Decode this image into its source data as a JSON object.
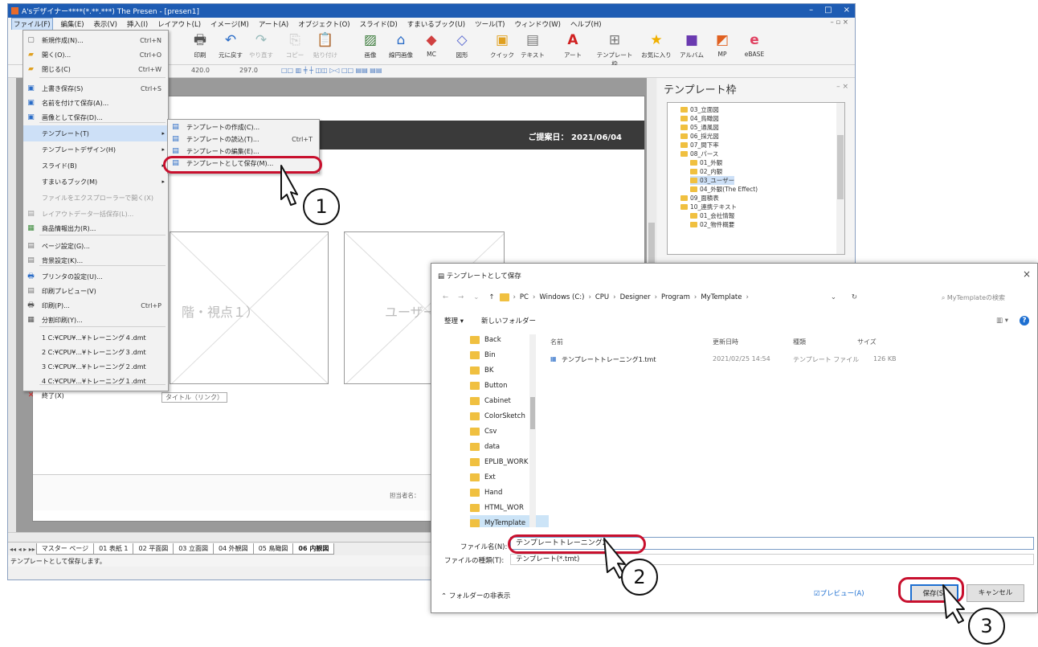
{
  "window": {
    "title": "A'sデザイナー****(*.**.***) The Presen - [presen1]",
    "controls": [
      "–",
      "□",
      "×"
    ]
  },
  "menubar": [
    "ファイル(F)",
    "編集(E)",
    "表示(V)",
    "挿入(I)",
    "レイアウト(L)",
    "イメージ(M)",
    "アート(A)",
    "オブジェクト(O)",
    "スライド(D)",
    "すまいるブック(U)",
    "ツール(T)",
    "ウィンドウ(W)",
    "ヘルプ(H)"
  ],
  "toolbar": [
    "印刷",
    "元に戻す",
    "やり直す",
    "コピー",
    "貼り付け",
    "画像",
    "線円画像",
    "MC",
    "図形",
    "クイック",
    "テキスト",
    "アート",
    "テンプレート枠",
    "お気に入り",
    "アルバム",
    "MP",
    "eBASE"
  ],
  "toolbar2": {
    "w": "420.0",
    "h": "297.0"
  },
  "page": {
    "date_label": "ご提案日： 2021/06/04",
    "frame1_text": "階・視点１）",
    "frame2_text": "ユーザー",
    "caption": "タイトル（リンク）",
    "footer_text": "担当者名："
  },
  "file_menu": [
    {
      "label": "新規作成(N)...",
      "shortcut": "Ctrl+N",
      "icon": "new-doc-icon"
    },
    {
      "label": "開く(O)...",
      "shortcut": "Ctrl+O",
      "icon": "open-folder-icon"
    },
    {
      "label": "閉じる(C)",
      "shortcut": "Ctrl+W",
      "icon": "close-doc-icon"
    },
    {
      "label": "上書き保存(S)",
      "shortcut": "Ctrl+S",
      "icon": "save-icon"
    },
    {
      "label": "名前を付けて保存(A)...",
      "shortcut": "",
      "icon": "save-as-icon"
    },
    {
      "label": "画像として保存(D)...",
      "shortcut": "",
      "icon": "save-image-icon"
    },
    {
      "label": "テンプレート(T)",
      "shortcut": "",
      "icon": ""
    },
    {
      "label": "テンプレートデザイン(H)",
      "shortcut": "",
      "icon": ""
    },
    {
      "label": "スライド(B)",
      "shortcut": "",
      "icon": ""
    },
    {
      "label": "すまいるブック(M)",
      "shortcut": "",
      "icon": ""
    },
    {
      "label": "ファイルをエクスプローラーで開く(X)",
      "shortcut": "",
      "icon": ""
    },
    {
      "label": "レイアウトデータ一括保存(L)...",
      "shortcut": "",
      "icon": "batch-save-icon"
    },
    {
      "label": "商品情報出力(R)...",
      "shortcut": "",
      "icon": "export-icon"
    },
    {
      "label": "ページ設定(G)...",
      "shortcut": "",
      "icon": "page-setup-icon"
    },
    {
      "label": "背景設定(K)...",
      "shortcut": "",
      "icon": "background-icon"
    },
    {
      "label": "プリンタの設定(U)...",
      "shortcut": "",
      "icon": "printer-setup-icon"
    },
    {
      "label": "印刷プレビュー(V)",
      "shortcut": "",
      "icon": "print-preview-icon"
    },
    {
      "label": "印刷(P)...",
      "shortcut": "Ctrl+P",
      "icon": "print-icon"
    },
    {
      "label": "分割印刷(Y)...",
      "shortcut": "",
      "icon": "split-print-icon"
    },
    {
      "label": "1 C:¥CPU¥...¥トレーニング４.dmt",
      "shortcut": "",
      "icon": ""
    },
    {
      "label": "2 C:¥CPU¥...¥トレーニング３.dmt",
      "shortcut": "",
      "icon": ""
    },
    {
      "label": "3 C:¥CPU¥...¥トレーニング２.dmt",
      "shortcut": "",
      "icon": ""
    },
    {
      "label": "4 C:¥CPU¥...¥トレーニング１.dmt",
      "shortcut": "",
      "icon": ""
    },
    {
      "label": "終了(X)",
      "shortcut": "",
      "icon": "exit-icon"
    }
  ],
  "submenu": [
    {
      "label": "テンプレートの作成(C)...",
      "shortcut": ""
    },
    {
      "label": "テンプレートの読込(T)...",
      "shortcut": "Ctrl+T"
    },
    {
      "label": "テンプレートの編集(E)...",
      "shortcut": ""
    },
    {
      "label": "テンプレートとして保存(M)...",
      "shortcut": ""
    }
  ],
  "template_panel": {
    "title": "テンプレート枠",
    "items": [
      "03_立面図",
      "04_鳥瞰図",
      "05_通風図",
      "06_採光図",
      "07_間下率",
      "08_パース",
      "01_外観",
      "02_内観",
      "03_ユーザー",
      "04_外観(The Effect)",
      "09_面積表",
      "10_連携テキスト",
      "01_会社情報",
      "02_物件概要"
    ]
  },
  "sheet_tabs": [
    "マスター ページ",
    "01 表紙 1",
    "02 平面図",
    "03 立面図",
    "04 外観図",
    "05 鳥瞰図",
    "06 内観図"
  ],
  "status": "テンプレートとして保存します。",
  "dialog": {
    "title": "テンプレートとして保存",
    "path": [
      "PC",
      "Windows (C:)",
      "CPU",
      "Designer",
      "Program",
      "MyTemplate"
    ],
    "search_placeholder": "MyTemplateの検索",
    "organize": "整理 ▾",
    "new_folder": "新しいフォルダー",
    "nav_items": [
      "Back",
      "Bin",
      "BK",
      "Button",
      "Cabinet",
      "ColorSketch",
      "Csv",
      "data",
      "EPLIB_WORK",
      "Ext",
      "Hand",
      "HTML_WOR",
      "MyTemplate"
    ],
    "columns": [
      "名前",
      "更新日時",
      "種類",
      "サイズ"
    ],
    "files": [
      {
        "name": "テンプレートトレーニング1.tmt",
        "date": "2021/02/25 14:54",
        "type": "テンプレート ファイル",
        "size": "126 KB"
      }
    ],
    "filename_label": "ファイル名(N):",
    "filename_value": "テンプレートトレーニング2",
    "filetype_label": "ファイルの種類(T):",
    "filetype_value": "テンプレート(*.tmt)",
    "hide_folders": "フォルダーの非表示",
    "preview": "プレビュー(A)",
    "save": "保存(S)",
    "cancel": "キャンセル"
  },
  "callouts": [
    "1",
    "2",
    "3"
  ],
  "colors": {
    "highlight": "#c8102e",
    "title_bar": "#1e5cb3",
    "accent": "#1d6fd1"
  }
}
